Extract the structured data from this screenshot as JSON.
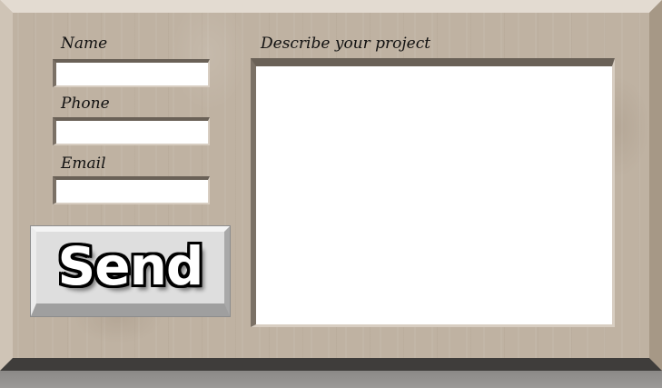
{
  "form": {
    "name": {
      "label": "Name",
      "value": ""
    },
    "phone": {
      "label": "Phone",
      "value": ""
    },
    "email": {
      "label": "Email",
      "value": ""
    },
    "project": {
      "label": "Describe your project",
      "value": ""
    },
    "send_label": "Send"
  },
  "colors": {
    "board": "#bfb2a2",
    "bevel_bottom": "#3f3d3b",
    "button_face": "#dedede",
    "field_background": "#ffffff"
  }
}
